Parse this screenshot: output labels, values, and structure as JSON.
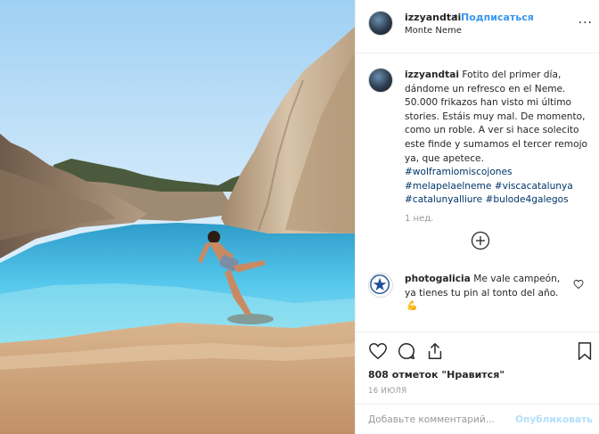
{
  "header": {
    "username": "izzyandtai",
    "separator": "•",
    "follow_label": "Подписаться",
    "location": "Monte Neme",
    "more_label": "..."
  },
  "caption": {
    "username": "izzyandtai",
    "text": "Fotito del primer día, dándome un refresco en el Neme. 50.000 frikazos han visto mi último stories. Estáis muy mal. De momento, como un roble. A ver si hace solecito este finde y sumamos el tercer remojo ya, que apetece.",
    "hashtags": [
      "#wolframiomiscojones",
      "#melapelaelneme",
      "#viscacatalunya",
      "#catalunyalliure",
      "#bulode4galegos"
    ],
    "time": "1 нед."
  },
  "comment": {
    "username": "photogalicia",
    "text": "Me vale campeón, ya tienes tu pin al tonto del año.",
    "emoji": "💪"
  },
  "actions": {
    "likes": "808 отметок \"Нравится\"",
    "date": "16 ИЮЛЯ"
  },
  "add_comment": {
    "placeholder": "Добавьте комментарий...",
    "publish_label": "Опубликовать"
  },
  "colors": {
    "link": "#3897f0",
    "hashtag": "#003569",
    "muted": "#999999",
    "water": "#4fc3e8",
    "sky": "#cfe9fb"
  }
}
